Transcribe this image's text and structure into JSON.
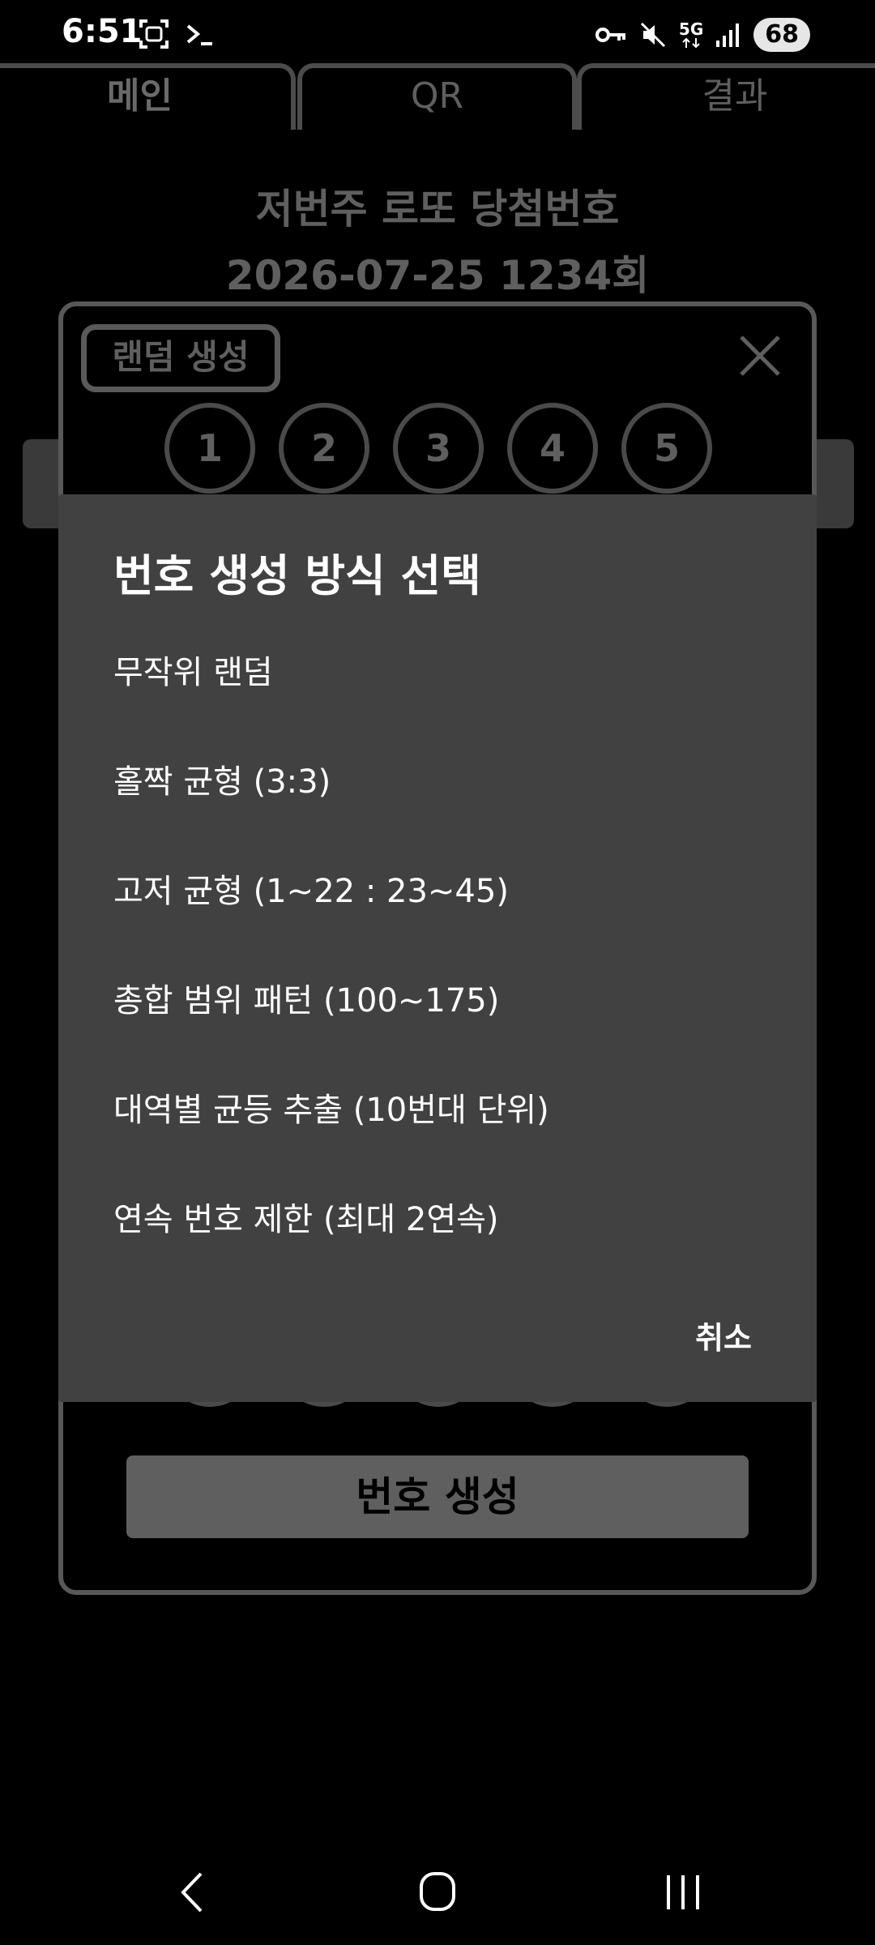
{
  "status": {
    "time": "6:51",
    "network": "5G",
    "battery": "68"
  },
  "tabs": [
    "메인",
    "QR",
    "결과"
  ],
  "header": {
    "title": "저번주 로또 당첨번호",
    "subtitle": "2026-07-25 1234회"
  },
  "panel": {
    "badge": "랜덤 생성",
    "balls": [
      "1",
      "2",
      "3",
      "4",
      "5"
    ],
    "generate_label": "번호 생성"
  },
  "dialog": {
    "title": "번호 생성 방식 선택",
    "options": [
      "무작위 랜덤",
      "홀짝 균형 (3:3)",
      "고저 균형 (1~22 : 23~45)",
      "총합 범위 패턴 (100~175)",
      "대역별 균등 추출 (10번대 단위)",
      "연속 번호 제한 (최대 2연속)"
    ],
    "cancel_label": "취소"
  }
}
